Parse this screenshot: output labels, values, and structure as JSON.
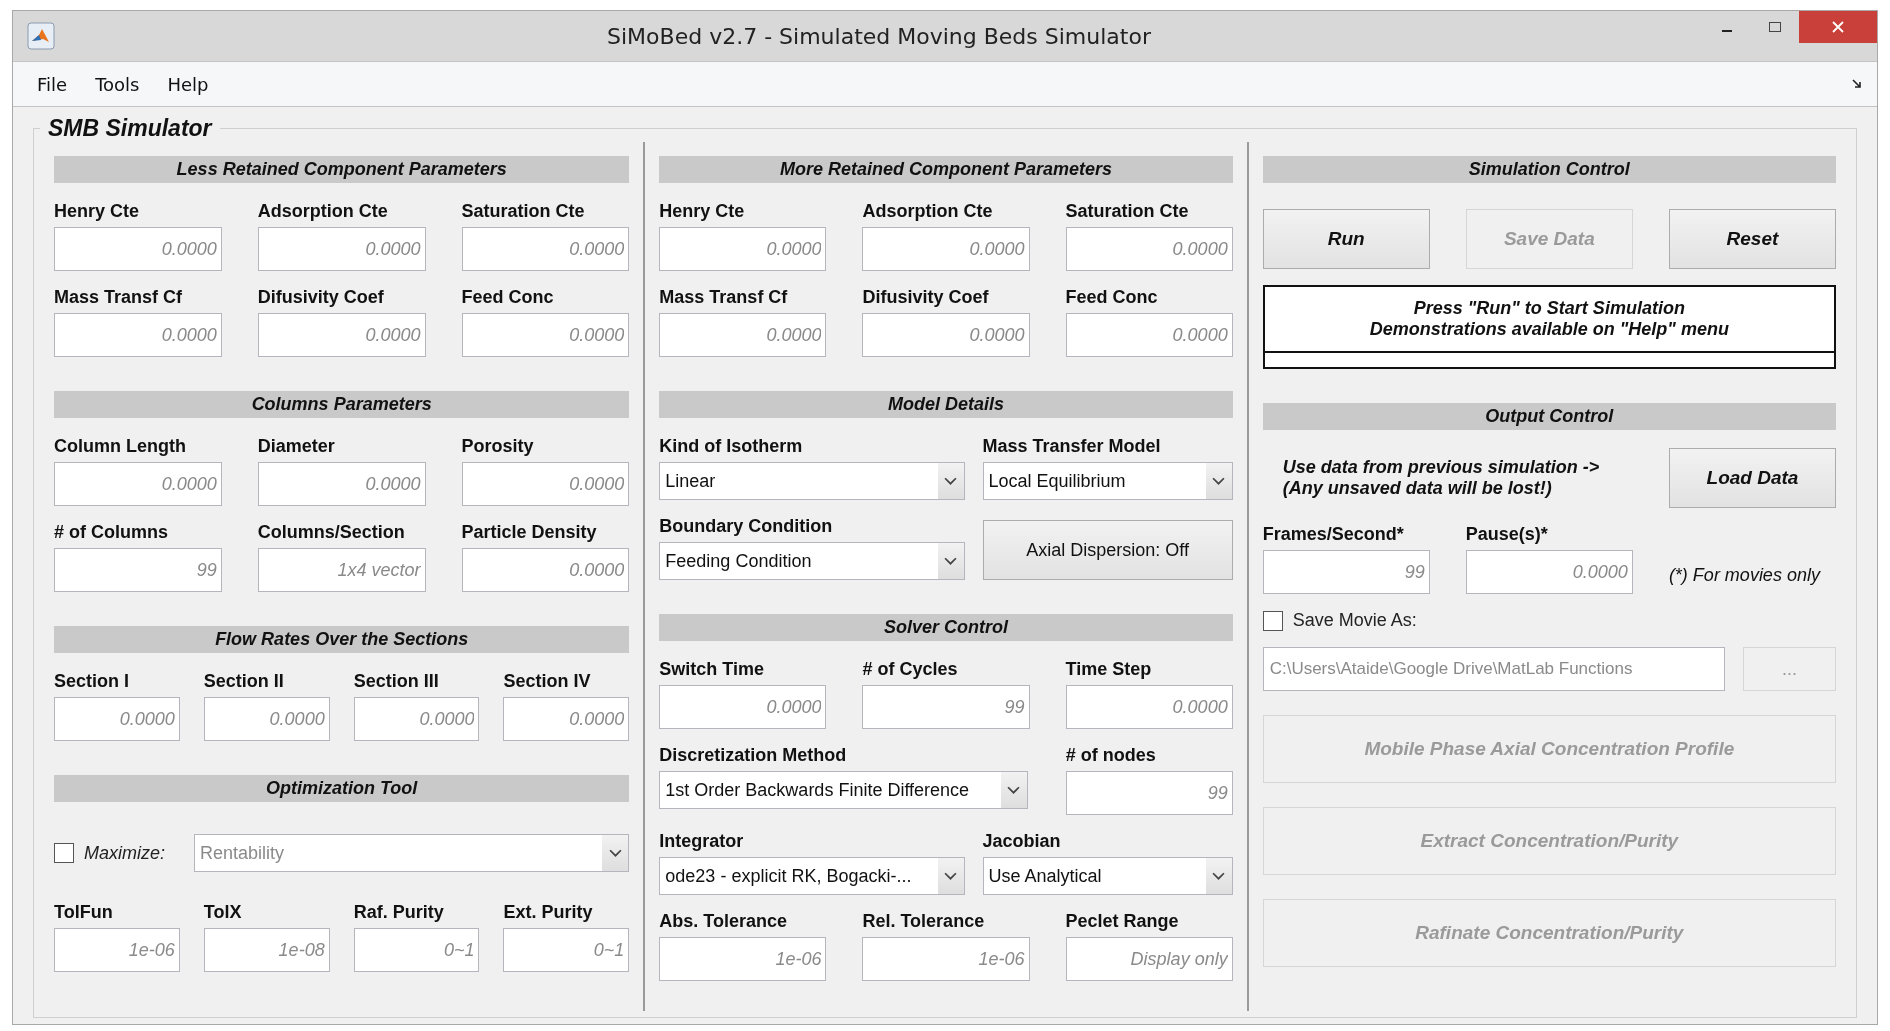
{
  "window": {
    "title": "SiMoBed v2.7 - Simulated Moving Beds Simulator"
  },
  "menu": [
    "File",
    "Tools",
    "Help"
  ],
  "panel": {
    "title": "SMB Simulator"
  },
  "columns": [
    {
      "sections": [
        {
          "heading": "Less Retained Component Parameters",
          "rows": [
            {
              "kind": "thirds",
              "items": [
                {
                  "kind": "field",
                  "label": "Henry Cte",
                  "placeholder": "0.0000"
                },
                {
                  "kind": "field",
                  "label": "Adsorption Cte",
                  "placeholder": "0.0000"
                },
                {
                  "kind": "field",
                  "label": "Saturation Cte",
                  "placeholder": "0.0000"
                }
              ]
            },
            {
              "kind": "thirds",
              "items": [
                {
                  "kind": "field",
                  "label": "Mass Transf Cf",
                  "placeholder": "0.0000"
                },
                {
                  "kind": "field",
                  "label": "Difusivity Coef",
                  "placeholder": "0.0000"
                },
                {
                  "kind": "field",
                  "label": "Feed Conc",
                  "placeholder": "0.0000"
                }
              ]
            }
          ]
        },
        {
          "heading": "Columns Parameters",
          "rows": [
            {
              "kind": "thirds",
              "items": [
                {
                  "kind": "field",
                  "label": "Column Length",
                  "placeholder": "0.0000"
                },
                {
                  "kind": "field",
                  "label": "Diameter",
                  "placeholder": "0.0000"
                },
                {
                  "kind": "field",
                  "label": "Porosity",
                  "placeholder": "0.0000"
                }
              ]
            },
            {
              "kind": "thirds",
              "items": [
                {
                  "kind": "field",
                  "label": "# of Columns",
                  "placeholder": "99"
                },
                {
                  "kind": "field",
                  "label": "Columns/Section",
                  "placeholder": "1x4 vector"
                },
                {
                  "kind": "field",
                  "label": "Particle Density",
                  "placeholder": "0.0000"
                }
              ]
            }
          ]
        },
        {
          "heading": "Flow Rates Over the Sections",
          "rows": [
            {
              "kind": "quarters",
              "items": [
                {
                  "kind": "field",
                  "label": "Section I",
                  "placeholder": "0.0000"
                },
                {
                  "kind": "field",
                  "label": "Section II",
                  "placeholder": "0.0000"
                },
                {
                  "kind": "field",
                  "label": "Section III",
                  "placeholder": "0.0000"
                },
                {
                  "kind": "field",
                  "label": "Section IV",
                  "placeholder": "0.0000"
                }
              ]
            }
          ]
        },
        {
          "heading": "Optimization Tool",
          "rows": [
            {
              "kind": "checkdrop",
              "items": [
                {
                  "kind": "checkbox",
                  "label": "Maximize:",
                  "checked": false
                },
                {
                  "kind": "dropdown",
                  "value": "Rentability",
                  "disabled": true
                }
              ]
            },
            {
              "kind": "quarters",
              "items": [
                {
                  "kind": "field",
                  "label": "TolFun",
                  "placeholder": "1e-06"
                },
                {
                  "kind": "field",
                  "label": "TolX",
                  "placeholder": "1e-08"
                },
                {
                  "kind": "field",
                  "label": "Raf. Purity",
                  "placeholder": "0~1"
                },
                {
                  "kind": "field",
                  "label": "Ext. Purity",
                  "placeholder": "0~1"
                }
              ]
            }
          ]
        }
      ]
    },
    {
      "sections": [
        {
          "heading": "More Retained Component Parameters",
          "rows": [
            {
              "kind": "thirds",
              "items": [
                {
                  "kind": "field",
                  "label": "Henry Cte",
                  "placeholder": "0.0000"
                },
                {
                  "kind": "field",
                  "label": "Adsorption Cte",
                  "placeholder": "0.0000"
                },
                {
                  "kind": "field",
                  "label": "Saturation Cte",
                  "placeholder": "0.0000"
                }
              ]
            },
            {
              "kind": "thirds",
              "items": [
                {
                  "kind": "field",
                  "label": "Mass Transf Cf",
                  "placeholder": "0.0000"
                },
                {
                  "kind": "field",
                  "label": "Difusivity Coef",
                  "placeholder": "0.0000"
                },
                {
                  "kind": "field",
                  "label": "Feed Conc",
                  "placeholder": "0.0000"
                }
              ]
            }
          ]
        },
        {
          "heading": "Model Details",
          "rows": [
            {
              "kind": "split",
              "items": [
                {
                  "kind": "dropdown",
                  "label": "Kind of Isotherm",
                  "value": "Linear",
                  "disabled": false
                },
                {
                  "kind": "dropdown",
                  "label": "Mass Transfer Model",
                  "value": "Local Equilibrium",
                  "disabled": false
                }
              ]
            },
            {
              "kind": "split",
              "items": [
                {
                  "kind": "dropdown",
                  "label": "Boundary Condition",
                  "value": "Feeding Condition",
                  "disabled": false
                },
                {
                  "kind": "button",
                  "label": "Axial Dispersion: Off",
                  "disabled": false
                }
              ]
            }
          ]
        },
        {
          "heading": "Solver Control",
          "rows": [
            {
              "kind": "thirds",
              "items": [
                {
                  "kind": "field",
                  "label": "Switch Time",
                  "placeholder": "0.0000"
                },
                {
                  "kind": "field",
                  "label": "# of Cycles",
                  "placeholder": "99"
                },
                {
                  "kind": "field",
                  "label": "Time Step",
                  "placeholder": "0.0000"
                }
              ]
            },
            {
              "kind": "wide",
              "items": [
                {
                  "kind": "dropdown",
                  "label": "Discretization Method",
                  "value": "1st Order Backwards Finite Difference",
                  "disabled": false
                },
                {
                  "kind": "field",
                  "label": "# of nodes",
                  "placeholder": "99"
                }
              ]
            },
            {
              "kind": "split",
              "items": [
                {
                  "kind": "dropdown",
                  "label": "Integrator",
                  "value": "ode23 - explicit RK, Bogacki-...",
                  "disabled": false
                },
                {
                  "kind": "dropdown",
                  "label": "Jacobian",
                  "value": "Use Analytical",
                  "disabled": false
                }
              ]
            },
            {
              "kind": "thirds",
              "items": [
                {
                  "kind": "field",
                  "label": "Abs. Tolerance",
                  "placeholder": "1e-06"
                },
                {
                  "kind": "field",
                  "label": "Rel. Tolerance",
                  "placeholder": "1e-06"
                },
                {
                  "kind": "field",
                  "label": "Peclet Range",
                  "placeholder": "Display only"
                }
              ]
            }
          ]
        }
      ]
    },
    {
      "sections": [
        {
          "heading": "Simulation Control",
          "rows": [
            {
              "kind": "thirds",
              "items": [
                {
                  "kind": "action-button",
                  "label": "Run",
                  "disabled": false
                },
                {
                  "kind": "action-button",
                  "label": "Save Data",
                  "disabled": true
                },
                {
                  "kind": "action-button",
                  "label": "Reset",
                  "disabled": false
                }
              ]
            },
            {
              "kind": "single",
              "items": [
                {
                  "kind": "message",
                  "lines": [
                    "Press \"Run\" to Start Simulation",
                    "Demonstrations available on \"Help\" menu"
                  ]
                }
              ]
            }
          ]
        },
        {
          "heading": "Output Control",
          "rows": [
            {
              "kind": "wide",
              "items": [
                {
                  "kind": "note",
                  "lines": [
                    "Use data from previous simulation ->",
                    "(Any unsaved data will be lost!)"
                  ]
                },
                {
                  "kind": "action-button",
                  "label": "Load Data",
                  "disabled": false
                }
              ]
            },
            {
              "kind": "thirds",
              "items": [
                {
                  "kind": "field",
                  "label": "Frames/Second*",
                  "placeholder": "99"
                },
                {
                  "kind": "field",
                  "label": "Pause(s)*",
                  "placeholder": "0.0000"
                },
                {
                  "kind": "hint",
                  "text": "(*) For movies only"
                }
              ]
            },
            {
              "kind": "single",
              "items": [
                {
                  "kind": "checkbox",
                  "label": "Save Movie As:",
                  "checked": false
                }
              ]
            },
            {
              "kind": "path",
              "items": [
                {
                  "kind": "path",
                  "value": "C:\\Users\\Ataide\\Google Drive\\MatLab Functions",
                  "disabled": true
                },
                {
                  "kind": "button",
                  "label": "...",
                  "disabled": true
                }
              ]
            },
            {
              "kind": "single",
              "items": [
                {
                  "kind": "plot-button",
                  "label": "Mobile Phase Axial Concentration Profile",
                  "disabled": true
                }
              ]
            },
            {
              "kind": "single",
              "items": [
                {
                  "kind": "plot-button",
                  "label": "Extract Concentration/Purity",
                  "disabled": true
                }
              ]
            },
            {
              "kind": "single",
              "items": [
                {
                  "kind": "plot-button",
                  "label": "Rafinate Concentration/Purity",
                  "disabled": true
                }
              ]
            }
          ]
        }
      ]
    }
  ]
}
